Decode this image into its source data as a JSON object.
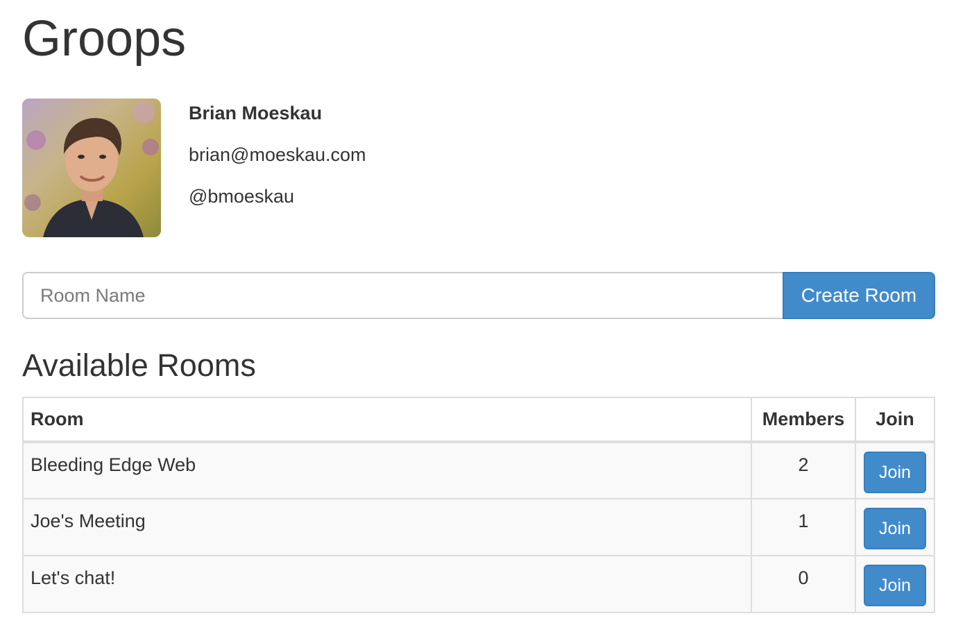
{
  "app": {
    "title": "Groops"
  },
  "profile": {
    "name": "Brian Moeskau",
    "email": "brian@moeskau.com",
    "handle": "@bmoeskau"
  },
  "create_room": {
    "placeholder": "Room Name",
    "button_label": "Create Room"
  },
  "rooms": {
    "heading": "Available Rooms",
    "columns": [
      "Room",
      "Members",
      "Join"
    ],
    "rows": [
      {
        "name": "Bleeding Edge Web",
        "members": "2",
        "action": "Join"
      },
      {
        "name": "Joe's Meeting",
        "members": "1",
        "action": "Join"
      },
      {
        "name": "Let's chat!",
        "members": "0",
        "action": "Join"
      }
    ]
  },
  "colors": {
    "primary": "#428bca",
    "primary_border": "#357ebd",
    "text": "#333333",
    "table_border": "#dddddd",
    "row_stripe": "#f9f9f9"
  }
}
